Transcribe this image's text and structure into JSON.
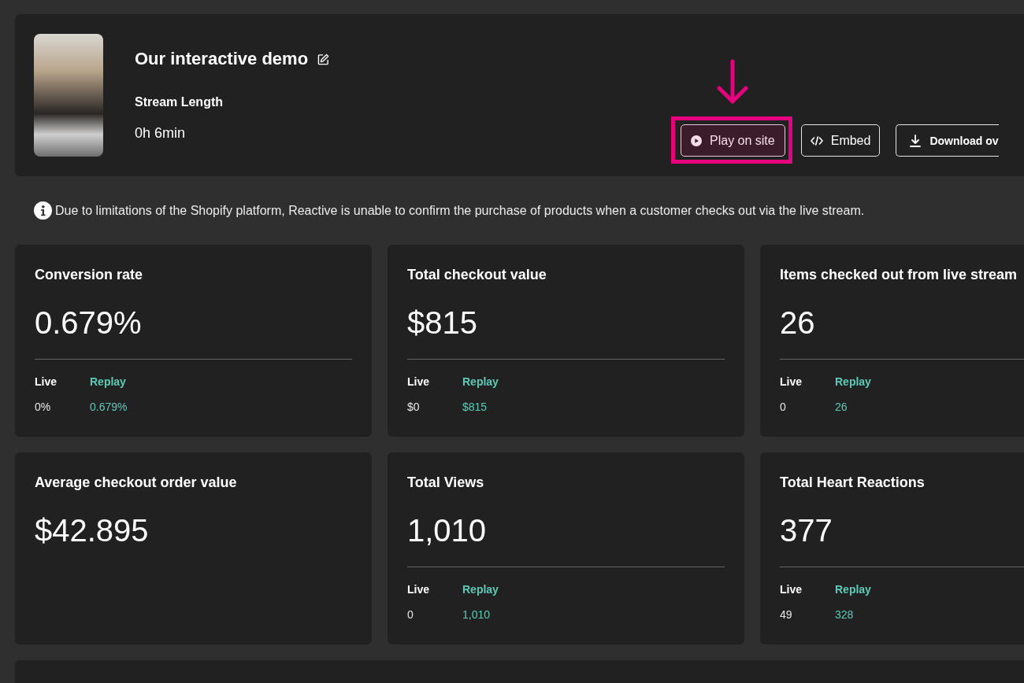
{
  "header": {
    "title": "Our interactive demo",
    "stream_length": {
      "label": "Stream Length",
      "value": "0h 6min"
    },
    "buttons": [
      {
        "kind": "play",
        "label": "Play on site",
        "highlighted": true
      },
      {
        "kind": "embed",
        "label": "Embed",
        "highlighted": false
      },
      {
        "kind": "download",
        "label": "Download ov",
        "highlighted": false
      }
    ]
  },
  "notice": "Due to limitations of the Shopify platform, Reactive is unable to confirm the purchase of products when a customer checks out via the live stream.",
  "metrics": [
    {
      "title": "Conversion rate",
      "value": "0.679%",
      "breakdown": [
        {
          "kind": "live",
          "label": "Live",
          "value": "0%"
        },
        {
          "kind": "replay",
          "label": "Replay",
          "value": "0.679%"
        }
      ]
    },
    {
      "title": "Total checkout value",
      "value": "$815",
      "breakdown": [
        {
          "kind": "live",
          "label": "Live",
          "value": "$0"
        },
        {
          "kind": "replay",
          "label": "Replay",
          "value": "$815"
        }
      ]
    },
    {
      "title": "Items checked out from live stream",
      "value": "26",
      "breakdown": [
        {
          "kind": "live",
          "label": "Live",
          "value": "0"
        },
        {
          "kind": "replay",
          "label": "Replay",
          "value": "26"
        }
      ]
    },
    {
      "title": "Average checkout order value",
      "value": "$42.895"
    },
    {
      "title": "Total Views",
      "value": "1,010",
      "breakdown": [
        {
          "kind": "live",
          "label": "Live",
          "value": "0"
        },
        {
          "kind": "replay",
          "label": "Replay",
          "value": "1,010"
        }
      ]
    },
    {
      "title": "Total Heart Reactions",
      "value": "377",
      "breakdown": [
        {
          "kind": "live",
          "label": "Live",
          "value": "49"
        },
        {
          "kind": "replay",
          "label": "Replay",
          "value": "328"
        }
      ]
    }
  ]
}
